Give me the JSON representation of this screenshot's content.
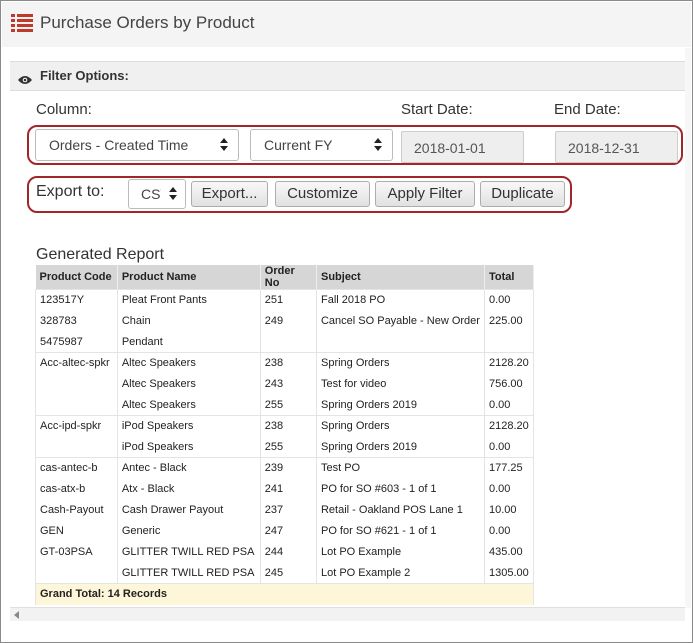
{
  "page": {
    "title": "Purchase Orders by Product",
    "filter_title": "Filter Options:"
  },
  "filters": {
    "column_label": "Column:",
    "start_date_label": "Start Date:",
    "end_date_label": "End Date:",
    "column_value": "Orders - Created Time",
    "period_value": "Current FY",
    "start_date": "2018-01-01",
    "end_date": "2018-12-31"
  },
  "export": {
    "label": "Export to:",
    "format_value": "CSV",
    "buttons": {
      "export": "Export...",
      "customize": "Customize",
      "apply_filter": "Apply Filter",
      "duplicate": "Duplicate"
    }
  },
  "report": {
    "title": "Generated Report",
    "columns": [
      "Product Code",
      "Product Name",
      "Order No",
      "Subject",
      "Total"
    ],
    "rows": [
      [
        "123517Y",
        "Pleat Front Pants",
        "251",
        "Fall 2018 PO",
        "0.00"
      ],
      [
        "328783",
        "Chain",
        "249",
        "Cancel SO Payable - New Order",
        "225.00"
      ],
      [
        "5475987",
        "Pendant",
        "",
        "",
        ""
      ],
      [
        "Acc-altec-spkr",
        "Altec Speakers",
        "238",
        "Spring Orders",
        "2128.20"
      ],
      [
        "",
        "Altec Speakers",
        "243",
        "Test for video",
        "756.00"
      ],
      [
        "",
        "Altec Speakers",
        "255",
        "Spring Orders 2019",
        "0.00"
      ],
      [
        "Acc-ipd-spkr",
        "iPod Speakers",
        "238",
        "Spring Orders",
        "2128.20"
      ],
      [
        "",
        "iPod Speakers",
        "255",
        "Spring Orders 2019",
        "0.00"
      ],
      [
        "cas-antec-b",
        "Antec - Black",
        "239",
        "Test PO",
        "177.25"
      ],
      [
        "cas-atx-b",
        "Atx - Black",
        "241",
        "PO for SO #603 - 1 of 1",
        "0.00"
      ],
      [
        "Cash-Payout",
        "Cash Drawer Payout",
        "237",
        "Retail - Oakland POS Lane 1",
        "10.00"
      ],
      [
        "GEN",
        "Generic",
        "247",
        "PO for SO #621 - 1 of 1",
        "0.00"
      ],
      [
        "GT-03PSA",
        "GLITTER TWILL RED PSA",
        "244",
        "Lot PO Example",
        "435.00"
      ],
      [
        "",
        "GLITTER TWILL RED PSA",
        "245",
        "Lot PO Example 2",
        "1305.00"
      ]
    ],
    "grand_total": "Grand Total: 14 Records"
  },
  "colors": {
    "highlight_border": "#a3252c",
    "title_icon": "#c0392b",
    "table_header": "#d6d6d6",
    "total_row": "#fdf6d8"
  }
}
